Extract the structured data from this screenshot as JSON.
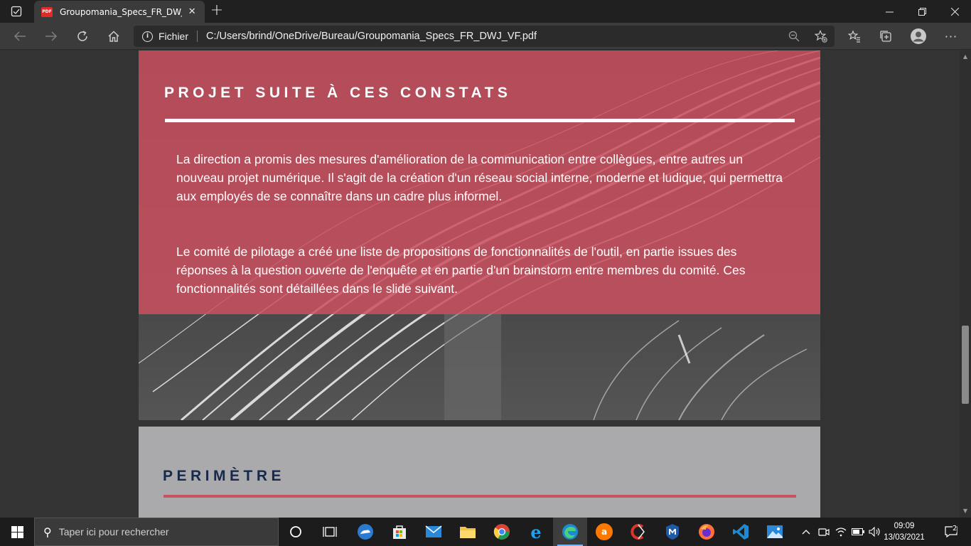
{
  "browser": {
    "tab_title": "Groupomania_Specs_FR_DWJ_VF.pdf",
    "pdf_badge": "PDF",
    "address_scheme": "Fichier",
    "address_url": "C:/Users/brind/OneDrive/Bureau/Groupomania_Specs_FR_DWJ_VF.pdf"
  },
  "document": {
    "section1_title": "PROJET SUITE À CES CONSTATS",
    "paragraph1": "La direction a promis des mesures d'amélioration de la communication entre collègues, entre autres un nouveau projet numérique. Il s'agit de la création d'un réseau social interne, moderne et ludique, qui permettra aux employés de se connaître dans un cadre plus informel.",
    "paragraph2": "Le comité de pilotage a créé une liste de propositions de fonctionnalités de l'outil, en partie issues des réponses à la question ouverte de l'enquête et en partie d'un brainstorm entre membres du comité. Ces fonctionnalités sont détaillées dans le slide suivant.",
    "section2_title": "PERIMÈTRE",
    "colors": {
      "accent_red": "#c9525f",
      "navy": "#17294d",
      "gray_page": "#aaa9ac"
    }
  },
  "taskbar": {
    "search_placeholder": "Taper ici pour rechercher",
    "time": "09:09",
    "date": "13/03/2021",
    "notification_count": "2"
  }
}
